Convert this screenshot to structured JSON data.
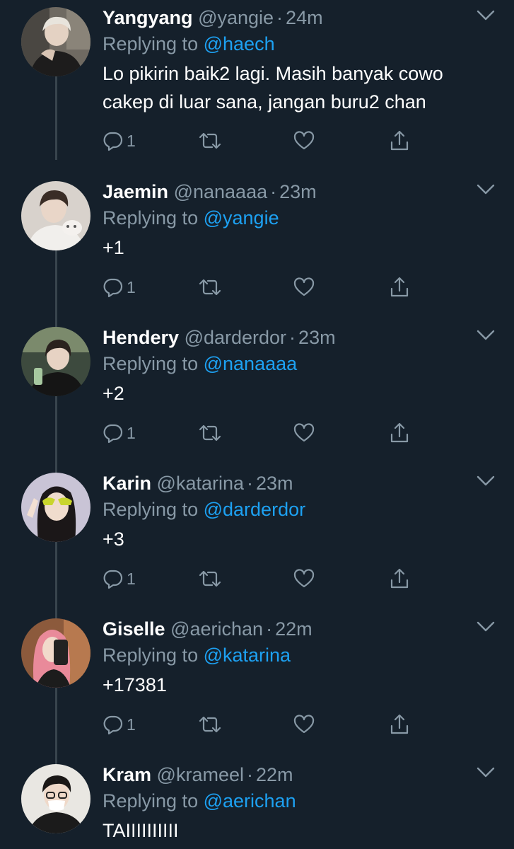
{
  "reply_prefix": "Replying to",
  "icons": {
    "reply": "reply-icon",
    "retweet": "retweet-icon",
    "like": "like-icon",
    "share": "share-icon",
    "more": "chevron-down-icon"
  },
  "colors": {
    "background": "#15202b",
    "secondary_text": "#8899a6",
    "link": "#1da1f2",
    "thread_line": "#38444d"
  },
  "tweets": [
    {
      "name": "Yangyang",
      "handle": "@yangie",
      "time": "24m",
      "reply_to": "@haech",
      "text": "Lo pikirin baik2 lagi. Masih banyak cowo cakep di luar sana, jangan buru2 chan",
      "reply_count": "1"
    },
    {
      "name": "Jaemin",
      "handle": "@nanaaaa",
      "time": "23m",
      "reply_to": "@yangie",
      "text": "+1",
      "reply_count": "1"
    },
    {
      "name": "Hendery",
      "handle": "@darderdor",
      "time": "23m",
      "reply_to": "@nanaaaa",
      "text": "+2",
      "reply_count": "1"
    },
    {
      "name": "Karin",
      "handle": "@katarina",
      "time": "23m",
      "reply_to": "@darderdor",
      "text": "+3",
      "reply_count": "1"
    },
    {
      "name": "Giselle",
      "handle": "@aerichan",
      "time": "22m",
      "reply_to": "@katarina",
      "text": "+17381",
      "reply_count": "1"
    },
    {
      "name": "Kram",
      "handle": "@krameel",
      "time": "22m",
      "reply_to": "@aerichan",
      "text": "TAIIIIIIIIII"
    }
  ]
}
